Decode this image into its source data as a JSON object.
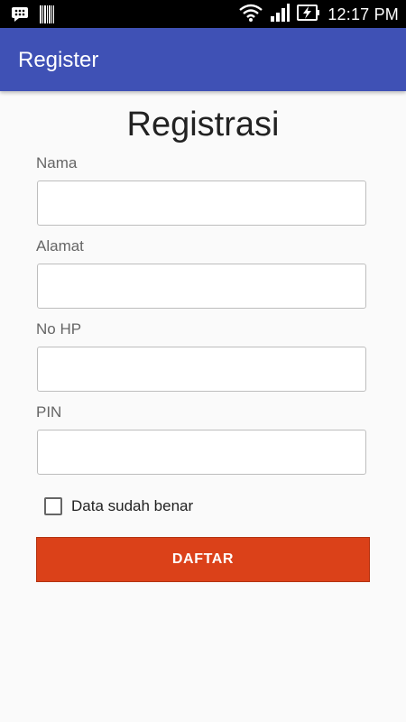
{
  "status_bar": {
    "time": "12:17 PM",
    "icons": [
      "bbm-icon",
      "barcode-icon",
      "wifi-icon",
      "signal-icon",
      "battery-charging-icon"
    ]
  },
  "app_bar": {
    "title": "Register",
    "color": "#3f51b5"
  },
  "form": {
    "title": "Registrasi",
    "fields": [
      {
        "label": "Nama",
        "value": ""
      },
      {
        "label": "Alamat",
        "value": ""
      },
      {
        "label": "No HP",
        "value": ""
      },
      {
        "label": "PIN",
        "value": ""
      }
    ],
    "checkbox": {
      "label": "Data sudah benar",
      "checked": false
    },
    "submit": {
      "label": "DAFTAR",
      "color": "#db4119"
    }
  }
}
